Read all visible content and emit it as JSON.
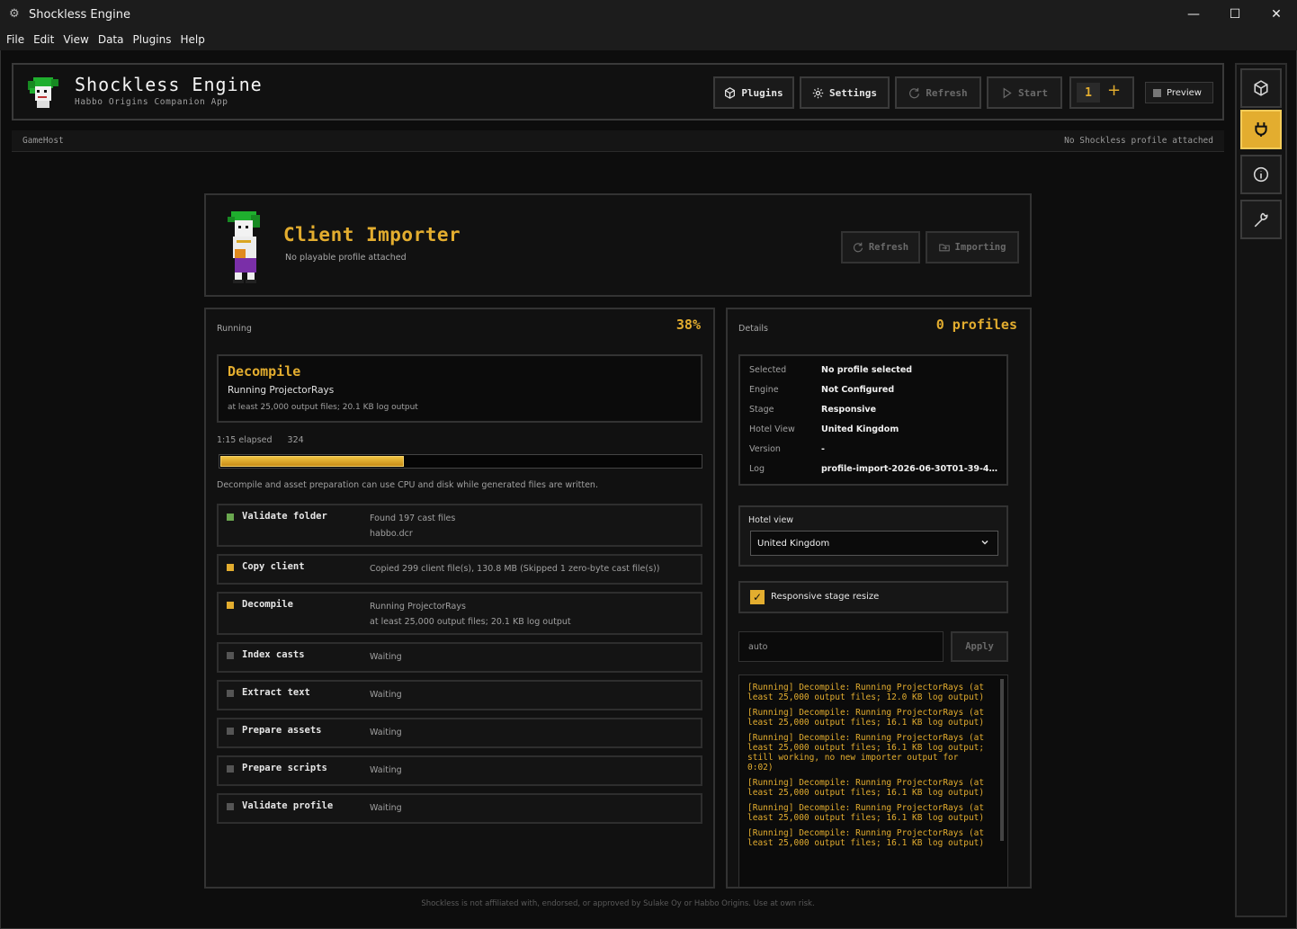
{
  "window": {
    "title": "Shockless Engine",
    "minimize": "—",
    "maximize": "☐",
    "close": "✕"
  },
  "menu": [
    "File",
    "Edit",
    "View",
    "Data",
    "Plugins",
    "Help"
  ],
  "header": {
    "brand": "Shockless Engine",
    "subtitle": "Habbo Origins Companion App",
    "buttons": {
      "plugins": "Plugins",
      "settings": "Settings",
      "refresh": "Refresh",
      "start": "Start"
    },
    "counter": "1",
    "counter_add": "+",
    "preview": "Preview"
  },
  "strip": {
    "left": "GameHost",
    "right": "No Shockless profile attached"
  },
  "importer": {
    "title": "Client Importer",
    "subtitle": "No playable profile attached",
    "refresh": "Refresh",
    "importing": "Importing"
  },
  "run": {
    "label": "Running",
    "percent": "38%",
    "progress_fraction": 0.38,
    "current": {
      "title": "Decompile",
      "line": "Running ProjectorRays",
      "detail": "at least 25,000 output files; 20.1 KB log output"
    },
    "elapsed": "1:15 elapsed",
    "count": "324",
    "note": "Decompile and asset preparation can use CPU and disk while generated files are written.",
    "steps": [
      {
        "name": "Validate folder",
        "d1": "Found 197 cast files",
        "d2": "habbo.dcr",
        "status": "done"
      },
      {
        "name": "Copy client",
        "d1": "Copied 299 client file(s), 130.8 MB (Skipped 1 zero-byte cast file(s))",
        "d2": "",
        "status": "active"
      },
      {
        "name": "Decompile",
        "d1": "Running ProjectorRays",
        "d2": "at least 25,000 output files; 20.1 KB log output",
        "status": "running"
      },
      {
        "name": "Index casts",
        "d1": "Waiting",
        "d2": "",
        "status": "waiting"
      },
      {
        "name": "Extract text",
        "d1": "Waiting",
        "d2": "",
        "status": "waiting"
      },
      {
        "name": "Prepare assets",
        "d1": "Waiting",
        "d2": "",
        "status": "waiting"
      },
      {
        "name": "Prepare scripts",
        "d1": "Waiting",
        "d2": "",
        "status": "waiting"
      },
      {
        "name": "Validate profile",
        "d1": "Waiting",
        "d2": "",
        "status": "waiting"
      }
    ]
  },
  "details": {
    "label": "Details",
    "profiles": "0 profiles",
    "rows": [
      {
        "k": "Selected",
        "v": "No profile selected"
      },
      {
        "k": "Engine",
        "v": "Not Configured"
      },
      {
        "k": "Stage",
        "v": "Responsive"
      },
      {
        "k": "Hotel View",
        "v": "United Kingdom"
      },
      {
        "k": "Version",
        "v": "-"
      },
      {
        "k": "Log",
        "v": "profile-import-2026-06-30T01-39-49-9..."
      }
    ],
    "hotel_label": "Hotel view",
    "hotel_value": "United Kingdom",
    "responsive_label": "Responsive stage resize",
    "responsive_checked": true,
    "auto_placeholder": "auto",
    "apply": "Apply",
    "log": [
      "[Running] Decompile: Running ProjectorRays (at least 25,000 output files; 12.0 KB log output)",
      "[Running] Decompile: Running ProjectorRays (at least 25,000 output files; 16.1 KB log output)",
      "[Running] Decompile: Running ProjectorRays (at least 25,000 output files; 16.1 KB log output; still working, no new importer output for 0:02)",
      "[Running] Decompile: Running ProjectorRays (at least 25,000 output files; 16.1 KB log output)",
      "[Running] Decompile: Running ProjectorRays (at least 25,000 output files; 16.1 KB log output)",
      "[Running] Decompile: Running ProjectorRays (at least 25,000 output files; 16.1 KB log output)"
    ]
  },
  "footer": "Shockless is not affiliated with, endorsed, or approved by Sulake Oy or Habbo Origins. Use at own risk.",
  "colors": {
    "accent": "#e3ad2f",
    "done": "#6aa84f",
    "waiting": "#555555"
  }
}
